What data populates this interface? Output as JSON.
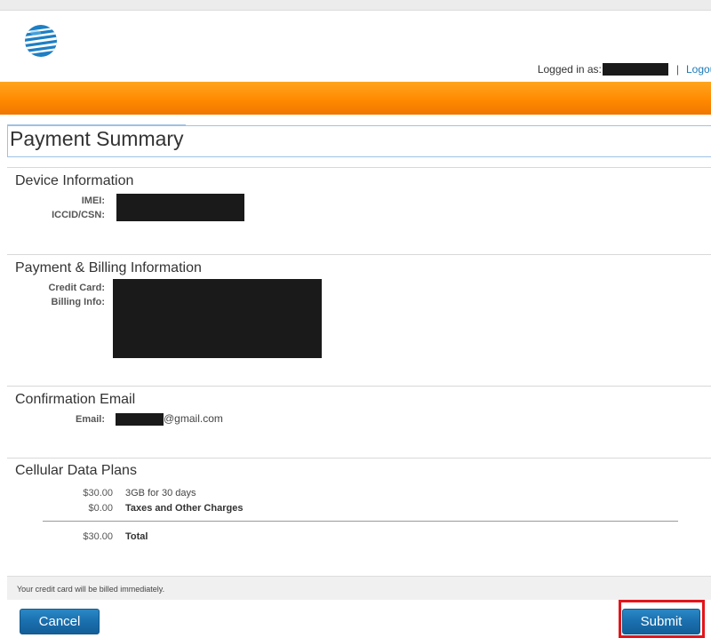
{
  "header": {
    "logo_icon": "att-globe-icon",
    "logged_in_label": "Logged in as:",
    "separator": "|",
    "logout_label": "Logout"
  },
  "page": {
    "title": "Payment Summary"
  },
  "device_info": {
    "title": "Device Information",
    "imei_label": "IMEI:",
    "iccid_label": "ICCID/CSN:"
  },
  "billing": {
    "title": "Payment & Billing Information",
    "credit_card_label": "Credit Card:",
    "billing_info_label": "Billing Info:"
  },
  "confirmation": {
    "title": "Confirmation Email",
    "email_label": "Email:",
    "email_suffix": "@gmail.com"
  },
  "plans": {
    "title": "Cellular Data Plans",
    "items": [
      {
        "amount": "$30.00",
        "description": "3GB for 30 days"
      },
      {
        "amount": "$0.00",
        "description": "Taxes and Other Charges"
      }
    ],
    "total_amount": "$30.00",
    "total_label": "Total"
  },
  "notice": "Your credit card will be billed immediately.",
  "actions": {
    "cancel_label": "Cancel",
    "submit_label": "Submit"
  },
  "colors": {
    "accent_orange": "#ff8a00",
    "button_blue": "#1a6fad",
    "highlight_red": "#e3151a"
  }
}
